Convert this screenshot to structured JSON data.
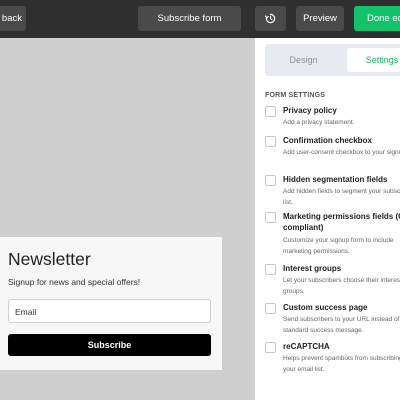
{
  "toolbar": {
    "back_label": "back",
    "form_label": "Subscribe form",
    "preview_label": "Preview",
    "done_label": "Done editing",
    "colors": {
      "bar": "#2f2f2f",
      "button": "#4a4a4a",
      "done": "#11c26b"
    }
  },
  "form": {
    "title": "Newsletter",
    "subtitle": "Signup for news and special offers!",
    "email_placeholder": "Email",
    "submit_label": "Subscribe"
  },
  "panel": {
    "tabs": {
      "design": "Design",
      "settings": "Settings"
    },
    "active_tab": "settings",
    "section_title": "FORM SETTINGS",
    "settings": [
      {
        "title": "Privacy policy",
        "desc": "Add a privacy statement.",
        "checked": false
      },
      {
        "title": "Confirmation checkbox",
        "desc": "Add user-consent checkbox to your signup form.",
        "checked": false
      },
      {
        "title": "Hidden segmentation fields",
        "desc": "Add hidden fields to segment your subscriber list.",
        "checked": false
      },
      {
        "title": "Marketing permissions fields (GDPR compliant)",
        "desc": "Customize your signup form to include marketing permissions.",
        "checked": false
      },
      {
        "title": "Interest groups",
        "desc": "Let your subscribers choose their interest groups.",
        "checked": false
      },
      {
        "title": "Custom success page",
        "desc": "Send subscribers to your URL instead of a standard success message.",
        "checked": false
      },
      {
        "title": "reCAPTCHA",
        "desc": "Helps prevent spambots from subscribing to your email list.",
        "checked": false
      }
    ],
    "accent_color": "#11b463"
  }
}
